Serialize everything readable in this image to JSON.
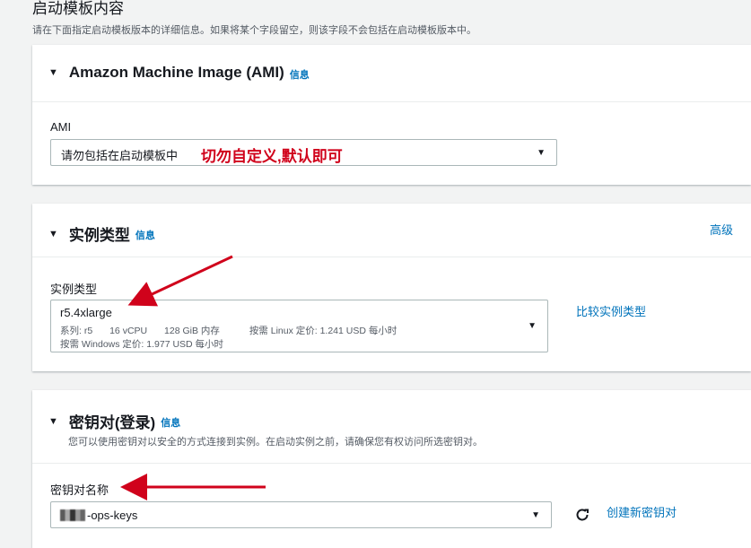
{
  "page": {
    "title": "启动模板内容",
    "description": "请在下面指定启动模板版本的详细信息。如果将某个字段留空，则该字段不会包括在启动模板版本中。"
  },
  "ami": {
    "title": "Amazon Machine Image (AMI)",
    "info": "信息",
    "label": "AMI",
    "value": "请勿包括在启动模板中",
    "annotation": "切勿自定义,默认即可"
  },
  "instance": {
    "title": "实例类型",
    "info": "信息",
    "advanced": "高级",
    "label": "实例类型",
    "value": "r5.4xlarge",
    "family": "系列: r5",
    "vcpu": "16 vCPU",
    "memory": "128 GiB 内存",
    "linux_price": "按需 Linux 定价: 1.241 USD 每小时",
    "windows_price": "按需 Windows 定价: 1.977 USD 每小时",
    "compare": "比较实例类型"
  },
  "keypair": {
    "title": "密钥对(登录)",
    "info": "信息",
    "description": "您可以使用密钥对以安全的方式连接到实例。在启动实例之前，请确保您有权访问所选密钥对。",
    "label": "密钥对名称",
    "value": "-ops-keys",
    "create": "创建新密钥对"
  },
  "colors": {
    "link": "#0073bb",
    "annotation": "#d0021b"
  }
}
